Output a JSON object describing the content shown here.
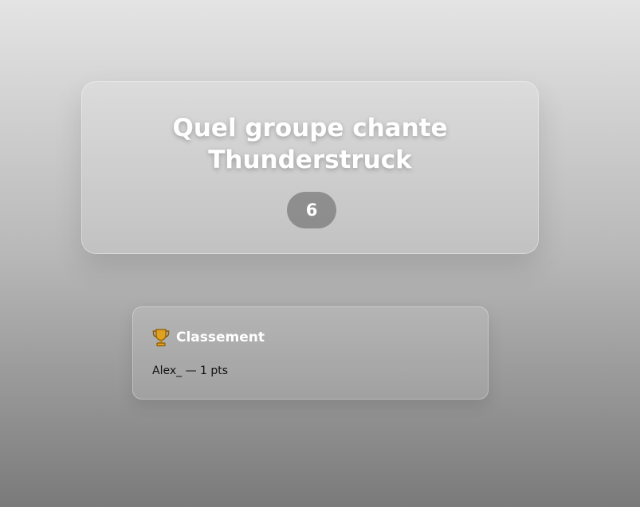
{
  "question": {
    "text": "Quel groupe chante Thunderstruck",
    "timer": "6"
  },
  "leaderboard": {
    "title": "Classement",
    "icon": "trophy-icon",
    "entries": [
      {
        "text": "Alex_ — 1 pts"
      }
    ]
  },
  "colors": {
    "trophy": "#e0a020",
    "card_text": "#ffffff",
    "entry_text": "#111111"
  }
}
